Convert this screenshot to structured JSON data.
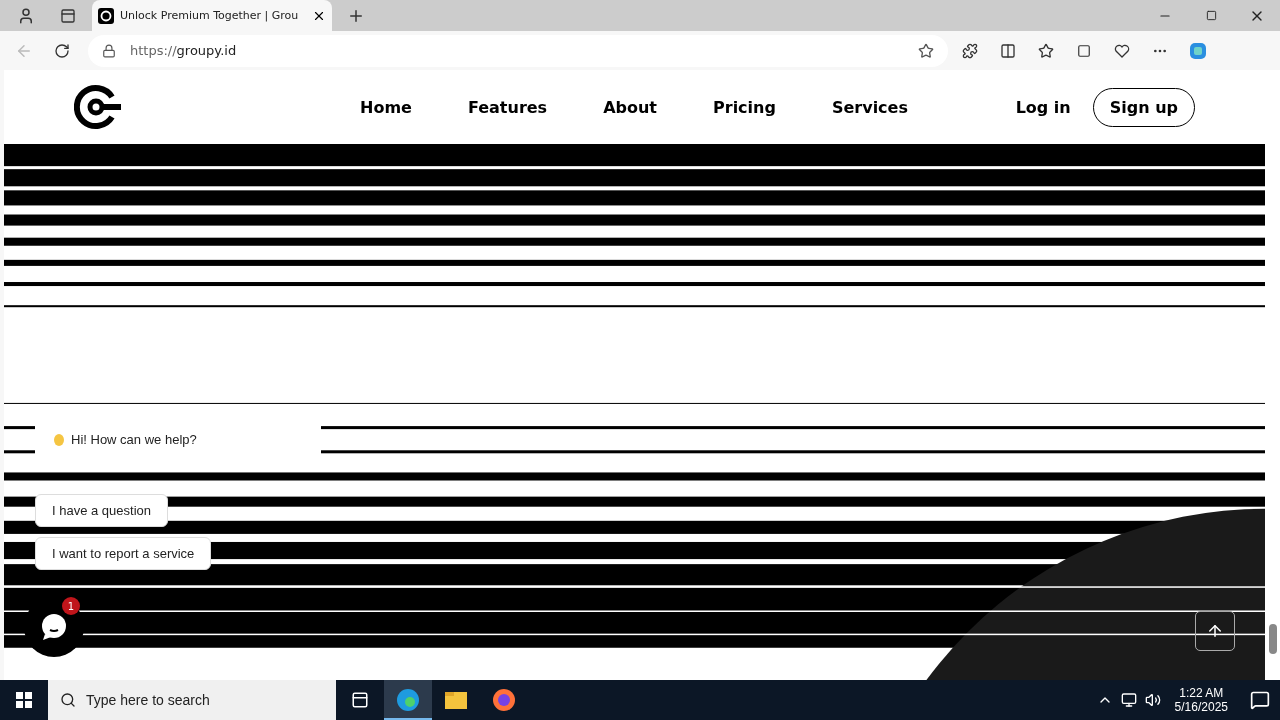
{
  "browser": {
    "tab_title": "Unlock Premium Together | Grou",
    "url_scheme": "https://",
    "url_host": "groupy.id"
  },
  "nav": {
    "items": [
      {
        "label": "Home"
      },
      {
        "label": "Features"
      },
      {
        "label": "About"
      },
      {
        "label": "Pricing"
      },
      {
        "label": "Services"
      }
    ],
    "login": "Log in",
    "signup": "Sign up"
  },
  "chat": {
    "greeting": "Hi! How can we help?",
    "replies": [
      "I have a question",
      "I want to report a service"
    ],
    "badge": "1"
  },
  "taskbar": {
    "search_placeholder": "Type here to search",
    "time": "1:22 AM",
    "date": "5/16/2025"
  }
}
